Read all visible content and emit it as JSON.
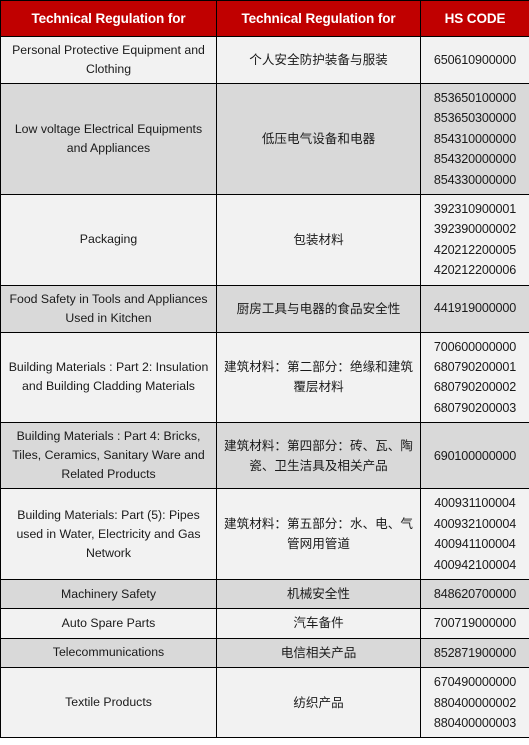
{
  "table": {
    "headers": {
      "col_en": "Technical Regulation for",
      "col_zh": "Technical Regulation for",
      "col_hs": "HS CODE"
    },
    "colors": {
      "header_background": "#C00000",
      "header_text": "#FFFFFF",
      "row_light": "#F2F2F2",
      "row_dark": "#D9D9D9",
      "border": "#000000",
      "body_text": "#1A1A1A"
    },
    "rows": [
      {
        "en": "Personal Protective Equipment and Clothing",
        "zh": "个人安全防护装备与服装",
        "hs": [
          "650610900000"
        ]
      },
      {
        "en": "Low voltage Electrical Equipments and Appliances",
        "zh": "低压电气设备和电器",
        "hs": [
          "853650100000",
          "853650300000",
          "854310000000",
          "854320000000",
          "854330000000"
        ]
      },
      {
        "en": "Packaging",
        "zh": "包装材料",
        "hs": [
          "392310900001",
          "392390000002",
          "420212200005",
          "420212200006"
        ]
      },
      {
        "en": "Food Safety in Tools and Appliances Used in Kitchen",
        "zh": "厨房工具与电器的食品安全性",
        "hs": [
          "441919000000"
        ]
      },
      {
        "en": "Building Materials : Part 2: Insulation and Building Cladding Materials",
        "zh": "建筑材料：第二部分：绝缘和建筑覆层材料",
        "hs": [
          "700600000000",
          "680790200001",
          "680790200002",
          "680790200003"
        ]
      },
      {
        "en": "Building Materials : Part 4: Bricks, Tiles, Ceramics, Sanitary Ware and Related Products",
        "zh": "建筑材料：第四部分：砖、瓦、陶瓷、卫生洁具及相关产品",
        "hs": [
          "690100000000"
        ]
      },
      {
        "en": "Building Materials: Part (5): Pipes used in Water, Electricity and Gas Network",
        "zh": "建筑材料：第五部分：水、电、气管网用管道",
        "hs": [
          "400931100004",
          "400932100004",
          "400941100004",
          "400942100004"
        ]
      },
      {
        "en": "Machinery Safety",
        "zh": "机械安全性",
        "hs": [
          "848620700000"
        ]
      },
      {
        "en": "Auto Spare Parts",
        "zh": "汽车备件",
        "hs": [
          "700719000000"
        ]
      },
      {
        "en": "Telecommunications",
        "zh": "电信相关产品",
        "hs": [
          "852871900000"
        ]
      },
      {
        "en": "Textile Products",
        "zh": "纺织产品",
        "hs": [
          "670490000000",
          "880400000002",
          "880400000003"
        ]
      }
    ]
  }
}
